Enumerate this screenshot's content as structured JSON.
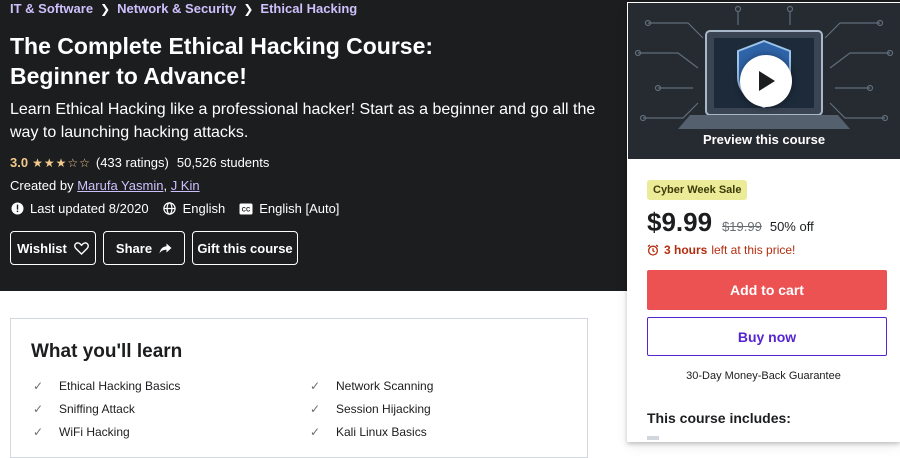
{
  "breadcrumb": [
    "IT & Software",
    "Network & Security",
    "Ethical Hacking"
  ],
  "course": {
    "title_line1": "The Complete Ethical Hacking Course:",
    "title_line2": "Beginner to Advance!",
    "subtitle": "Learn Ethical Hacking like a professional hacker! Start as a beginner and go all the way to launching hacking attacks.",
    "rating": "3.0",
    "stars": "★★★☆☆",
    "ratings_count": "(433 ratings)",
    "students": "50,526 students",
    "created_by_label": "Created by",
    "instructors": [
      "Marufa Yasmin",
      "J Kin"
    ],
    "last_updated": "Last updated 8/2020",
    "language": "English",
    "captions": "English [Auto]"
  },
  "actions": {
    "wishlist": "Wishlist",
    "share": "Share",
    "gift": "Gift this course"
  },
  "sidebar": {
    "preview_label": "Preview this course",
    "sale_badge": "Cyber Week Sale",
    "price": "$9.99",
    "original_price": "$19.99",
    "discount": "50% off",
    "timer_hours": "3 hours",
    "timer_text": "left at this price!",
    "add_to_cart": "Add to cart",
    "buy_now": "Buy now",
    "guarantee": "30-Day Money-Back Guarantee",
    "includes_title": "This course includes:"
  },
  "learn": {
    "title": "What you'll learn",
    "items": [
      "Ethical Hacking Basics",
      "Network Scanning",
      "Sniffing Attack",
      "Session Hijacking",
      "WiFi Hacking",
      "Kali Linux Basics"
    ]
  },
  "colors": {
    "hero_bg": "#1c1d1f",
    "link_purple": "#cec0fc",
    "star_gold": "#f3ca8c",
    "cart_red": "#ec5252",
    "buy_purple": "#5624d0",
    "badge_yellow": "#eceb98",
    "timer_red": "#b32d0f"
  }
}
